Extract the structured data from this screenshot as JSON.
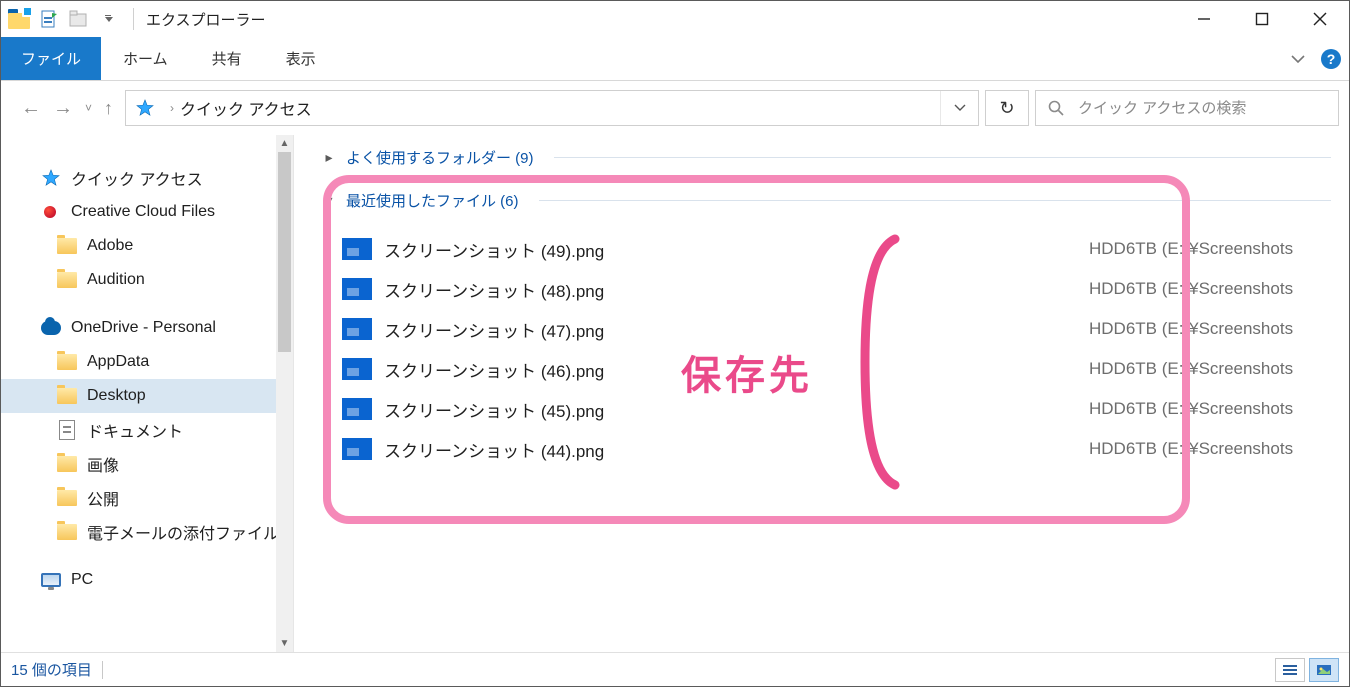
{
  "window": {
    "title": "エクスプローラー"
  },
  "ribbon": {
    "file": "ファイル",
    "home": "ホーム",
    "share": "共有",
    "view": "表示"
  },
  "nav": {
    "breadcrumb": "クイック アクセス",
    "search_placeholder": "クイック アクセスの検索"
  },
  "sidebar": {
    "items": [
      {
        "name": "quick-access",
        "label": "クイック アクセス",
        "icon": "star",
        "level": 0
      },
      {
        "name": "creative-cloud",
        "label": "Creative Cloud Files",
        "icon": "cc",
        "level": 0
      },
      {
        "name": "adobe",
        "label": "Adobe",
        "icon": "folder",
        "level": 1
      },
      {
        "name": "audition",
        "label": "Audition",
        "icon": "folder",
        "level": 1
      },
      {
        "name": "spacer"
      },
      {
        "name": "onedrive",
        "label": "OneDrive - Personal",
        "icon": "cloud",
        "level": 0
      },
      {
        "name": "appdata",
        "label": "AppData",
        "icon": "folder",
        "level": 1
      },
      {
        "name": "desktop",
        "label": "Desktop",
        "icon": "folder",
        "level": 1,
        "selected": true
      },
      {
        "name": "documents",
        "label": "ドキュメント",
        "icon": "doc",
        "level": 1
      },
      {
        "name": "pictures",
        "label": "画像",
        "icon": "folder",
        "level": 1
      },
      {
        "name": "public",
        "label": "公開",
        "icon": "folder",
        "level": 1
      },
      {
        "name": "email-attach",
        "label": "電子メールの添付ファイル",
        "icon": "folder",
        "level": 1
      },
      {
        "name": "spacer"
      },
      {
        "name": "pc",
        "label": "PC",
        "icon": "pc",
        "level": 0
      }
    ]
  },
  "content": {
    "group_frequent": "よく使用するフォルダー (9)",
    "group_recent": "最近使用したファイル (6)",
    "files": [
      {
        "name": "スクリーンショット (49).png",
        "path": "HDD6TB (E:)¥Screenshots"
      },
      {
        "name": "スクリーンショット (48).png",
        "path": "HDD6TB (E:)¥Screenshots"
      },
      {
        "name": "スクリーンショット (47).png",
        "path": "HDD6TB (E:)¥Screenshots"
      },
      {
        "name": "スクリーンショット (46).png",
        "path": "HDD6TB (E:)¥Screenshots"
      },
      {
        "name": "スクリーンショット (45).png",
        "path": "HDD6TB (E:)¥Screenshots"
      },
      {
        "name": "スクリーンショット (44).png",
        "path": "HDD6TB (E:)¥Screenshots"
      }
    ]
  },
  "annotation": {
    "label": "保存先"
  },
  "statusbar": {
    "items": "15 個の項目"
  }
}
